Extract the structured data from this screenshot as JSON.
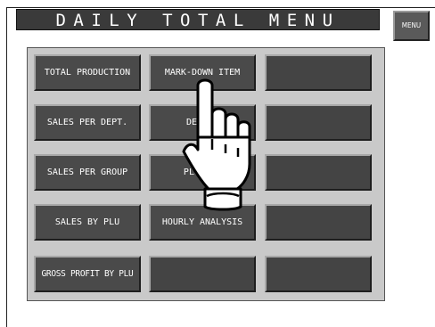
{
  "title": "DAILY TOTAL MENU",
  "menu_button": "MENU",
  "buttons": [
    {
      "label": "TOTAL PRODUCTION"
    },
    {
      "label": "MARK-DOWN ITEM"
    },
    {
      "label": ""
    },
    {
      "label": "SALES PER DEPT."
    },
    {
      "label": "DESIGN"
    },
    {
      "label": ""
    },
    {
      "label": "SALES PER GROUP"
    },
    {
      "label": "PLU ANA"
    },
    {
      "label": ""
    },
    {
      "label": "SALES BY PLU"
    },
    {
      "label": "HOURLY ANALYSIS"
    },
    {
      "label": ""
    },
    {
      "label": "GROSS PROFIT BY PLU"
    },
    {
      "label": ""
    },
    {
      "label": ""
    }
  ],
  "colors": {
    "title_bg": "#3a3a3a",
    "panel_bg": "#c9c9c9",
    "button_bg": "#4a4a4a",
    "button_text": "#ffffff"
  },
  "pointer_icon": "hand-pointer-icon"
}
